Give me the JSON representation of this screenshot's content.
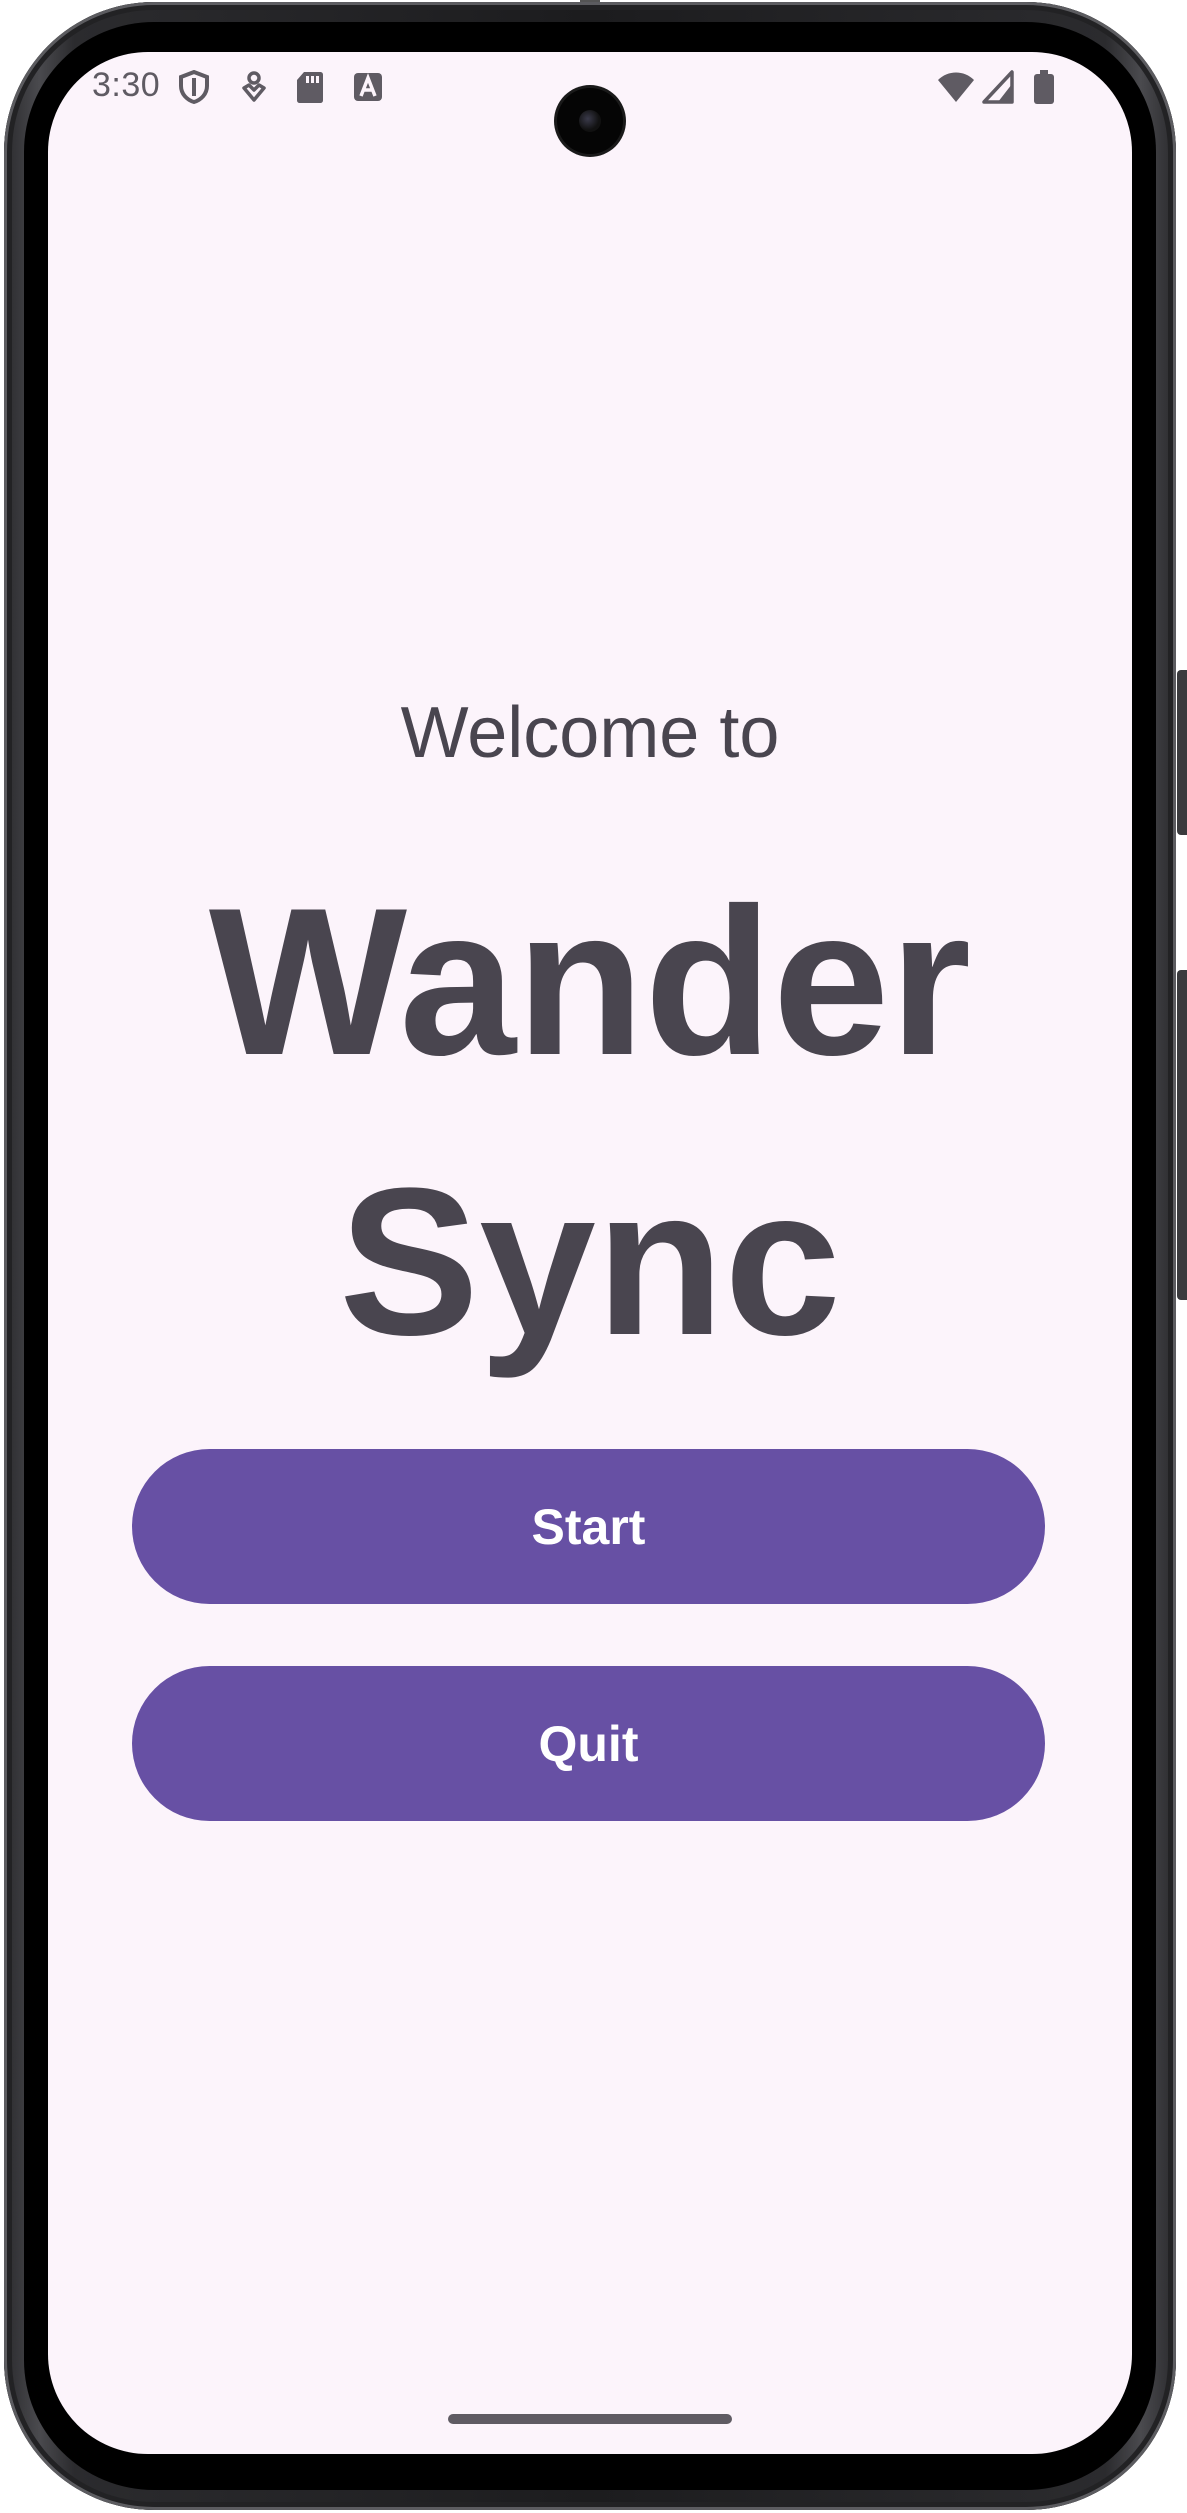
{
  "status_bar": {
    "time": "3:30",
    "left_icons": [
      "shield-icon",
      "location-heart-icon",
      "sd-card-icon",
      "text-a-icon"
    ],
    "right_icons": [
      "wifi-icon",
      "cellular-signal-icon",
      "battery-icon"
    ]
  },
  "main": {
    "welcome_text": "Welcome to",
    "title_line1": "Wander",
    "title_line2": "Sync",
    "start_label": "Start",
    "quit_label": "Quit"
  },
  "colors": {
    "background": "#fcf4fb",
    "primary": "#6750a4",
    "text": "#49454f",
    "on_primary": "#ffffff"
  }
}
